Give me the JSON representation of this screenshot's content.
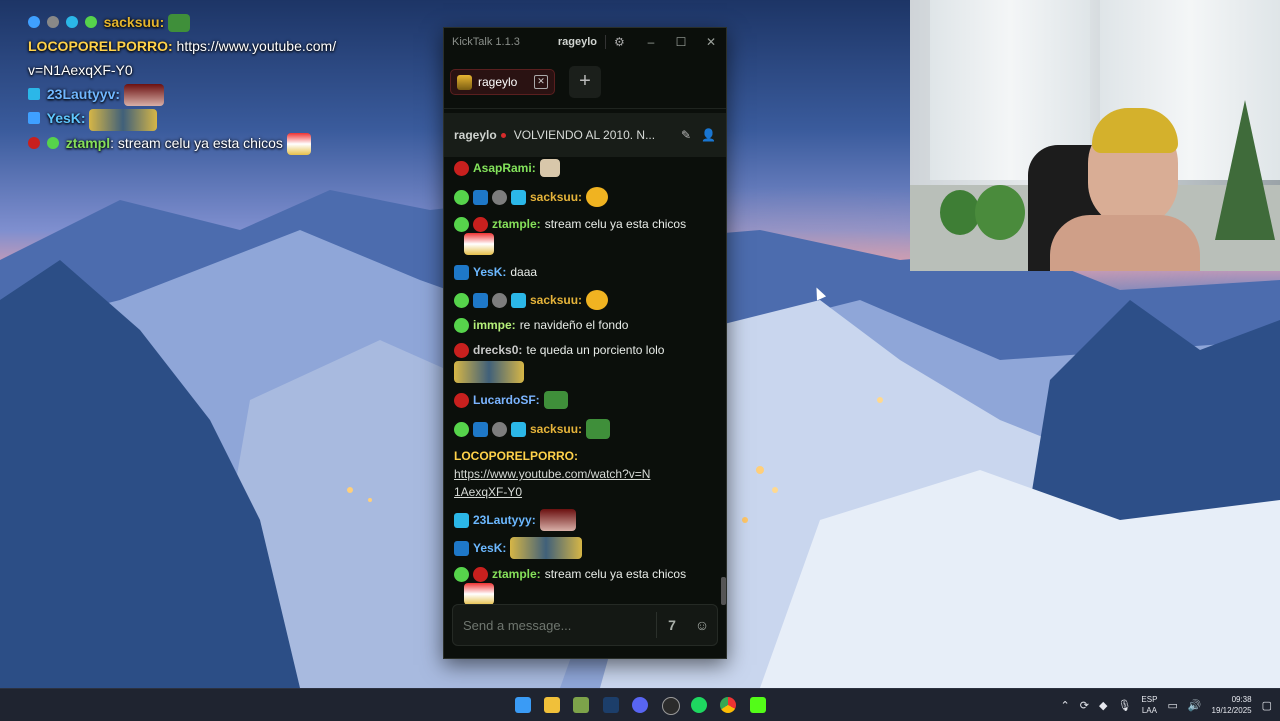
{
  "overlay": {
    "lines": [
      {
        "user": "sacksuu:",
        "msg": "",
        "color": "#e5b52d"
      },
      {
        "user": "LOCOPORELPORRO:",
        "msg": " https://www.youtube.com/",
        "msg2": "v=N1AexqXF-Y0",
        "color": "#ffd24a"
      },
      {
        "user": "23Lautyyv:",
        "msg": "",
        "color": "#70b7ff"
      },
      {
        "user": "YesK:",
        "msg": "",
        "color": "#5fc7ff"
      },
      {
        "user": "ztampl",
        "msg": ": stream celu ya esta chicos",
        "color": "#86e05a"
      }
    ]
  },
  "kicktalk": {
    "app_title": "KickTalk 1.1.3",
    "titlebar_user": "rageylo",
    "tab_label": "rageylo",
    "add_tab": "+",
    "stream_user": "rageylo",
    "stream_title": "VOLVIENDO AL 2010. N...",
    "input_placeholder": "Send a message...",
    "messages": [
      {
        "user": "AsapRami:",
        "text": "",
        "color": "#83e35b"
      },
      {
        "user": "sacksuu:",
        "text": "",
        "color": "#e6b43a"
      },
      {
        "user": "ztample:",
        "text": "stream celu ya esta chicos",
        "color": "#86e05a"
      },
      {
        "user": "YesK:",
        "text": "daaa",
        "color": "#6cb8ff"
      },
      {
        "user": "sacksuu:",
        "text": "",
        "color": "#e6b43a"
      },
      {
        "user": "immpe:",
        "text": "re navideño el fondo",
        "color": "#b6f07a"
      },
      {
        "user": "drecks0:",
        "text": "te queda un porciento lolo",
        "color": "#c9c9c9"
      },
      {
        "user": "LucardoSF:",
        "text": "",
        "color": "#7bb4ff"
      },
      {
        "user": "sacksuu:",
        "text": "",
        "color": "#e6b43a"
      },
      {
        "user": "LOCOPORELPORRO:",
        "text": "",
        "link": "https://www.youtube.com/watch?v=N1AexqXF-Y0",
        "color": "#ffd24a"
      },
      {
        "user": "23Lautyyy:",
        "text": "",
        "color": "#6cb8ff"
      },
      {
        "user": "YesK:",
        "text": "",
        "color": "#6cb8ff"
      },
      {
        "user": "ztample:",
        "text": "stream celu ya esta chicos",
        "color": "#86e05a"
      }
    ]
  },
  "tray": {
    "lang_top": "ESP",
    "lang_bottom": "LAA",
    "time": "09:38",
    "date": "19/12/2025"
  }
}
